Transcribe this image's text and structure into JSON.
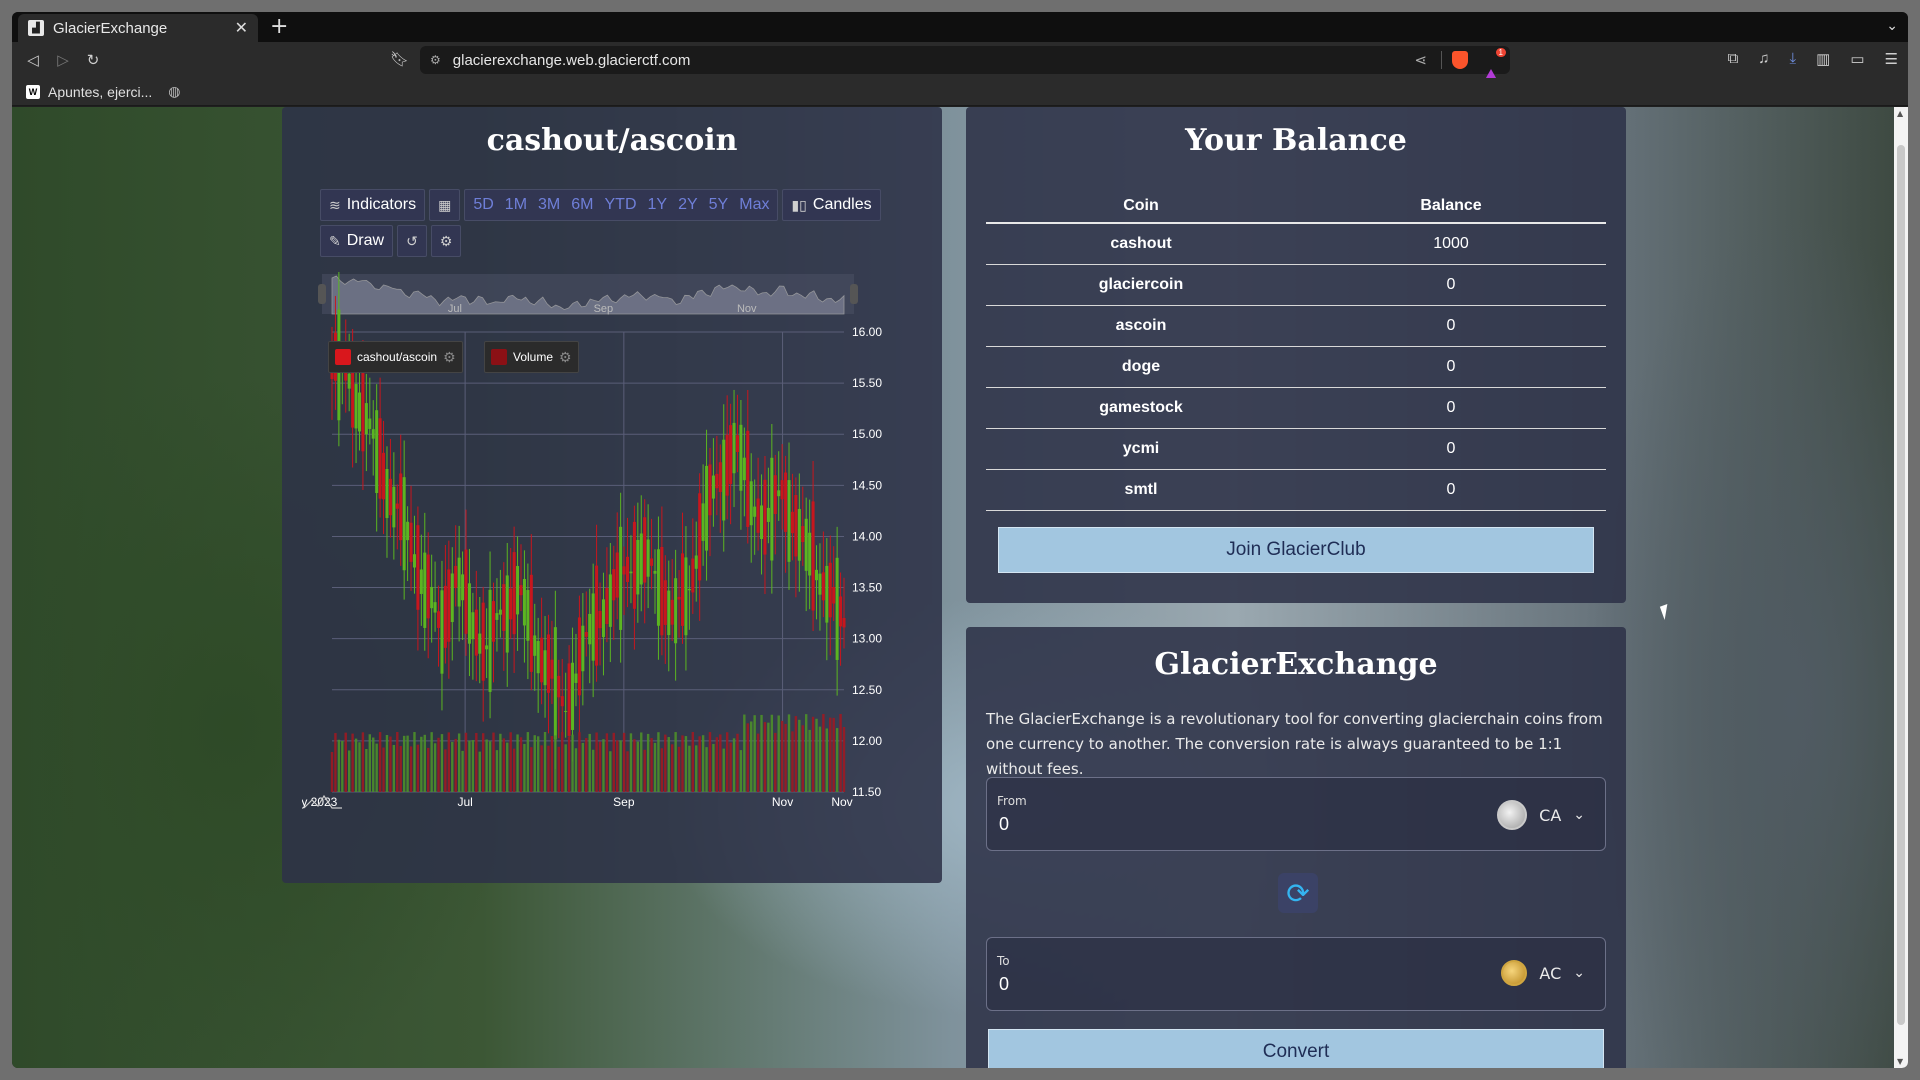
{
  "browser": {
    "tab_title": "GlacierExchange",
    "tab_close": "✕",
    "new_tab": "+",
    "url": "glacierexchange.web.glacierctf.com",
    "bookmark_label": "Apuntes, ejerci...",
    "bookmark_icon_text": "W"
  },
  "chart_panel": {
    "title": "cashout/ascoin",
    "indicators_label": "Indicators",
    "ranges": [
      "5D",
      "1M",
      "3M",
      "6M",
      "YTD",
      "1Y",
      "2Y",
      "5Y",
      "Max"
    ],
    "candles_label": "Candles",
    "draw_label": "Draw",
    "legend_series": "cashout/ascoin",
    "legend_volume": "Volume"
  },
  "chart_data": {
    "type": "candlestick",
    "x_ticks": [
      "ay 2023",
      "Jul",
      "Sep",
      "Nov",
      "Nov"
    ],
    "navigator_ticks": [
      "Jul",
      "Sep",
      "Nov"
    ],
    "y_ticks": [
      "16.00",
      "15.50",
      "15.00",
      "14.50",
      "14.00",
      "13.50",
      "13.00",
      "12.50",
      "12.00",
      "11.50"
    ],
    "ylim": [
      11.5,
      16.0
    ],
    "series": [
      {
        "name": "cashout/ascoin",
        "approx_close": [
          15.7,
          15.6,
          15.2,
          14.8,
          14.3,
          14.0,
          13.5,
          13.1,
          13.6,
          13.2,
          12.9,
          13.3,
          13.5,
          13.0,
          12.7,
          12.3,
          12.8,
          13.2,
          13.4,
          13.7,
          13.8,
          13.6,
          13.2,
          13.5,
          14.2,
          14.6,
          14.9,
          14.4,
          14.1,
          14.5,
          14.0,
          13.8,
          13.4,
          13.2
        ]
      },
      {
        "name": "Volume",
        "approx_values": "bars"
      }
    ],
    "colors": {
      "up": "#5bb521",
      "down": "#c8161d"
    }
  },
  "balance": {
    "title": "Your Balance",
    "col_coin": "Coin",
    "col_balance": "Balance",
    "rows": [
      {
        "coin": "cashout",
        "balance": "1000"
      },
      {
        "coin": "glaciercoin",
        "balance": "0"
      },
      {
        "coin": "ascoin",
        "balance": "0"
      },
      {
        "coin": "doge",
        "balance": "0"
      },
      {
        "coin": "gamestock",
        "balance": "0"
      },
      {
        "coin": "ycmi",
        "balance": "0"
      },
      {
        "coin": "smtl",
        "balance": "0"
      }
    ],
    "join_button": "Join GlacierClub"
  },
  "exchange": {
    "title": "GlacierExchange",
    "description": "The GlacierExchange is a revolutionary tool for converting glacierchain coins from one currency to another. The conversion rate is always guaranteed to be 1:1 without fees.",
    "from_label": "From",
    "from_value": "0",
    "from_coin": "CA",
    "to_label": "To",
    "to_value": "0",
    "to_coin": "AC",
    "convert_button": "Convert"
  }
}
